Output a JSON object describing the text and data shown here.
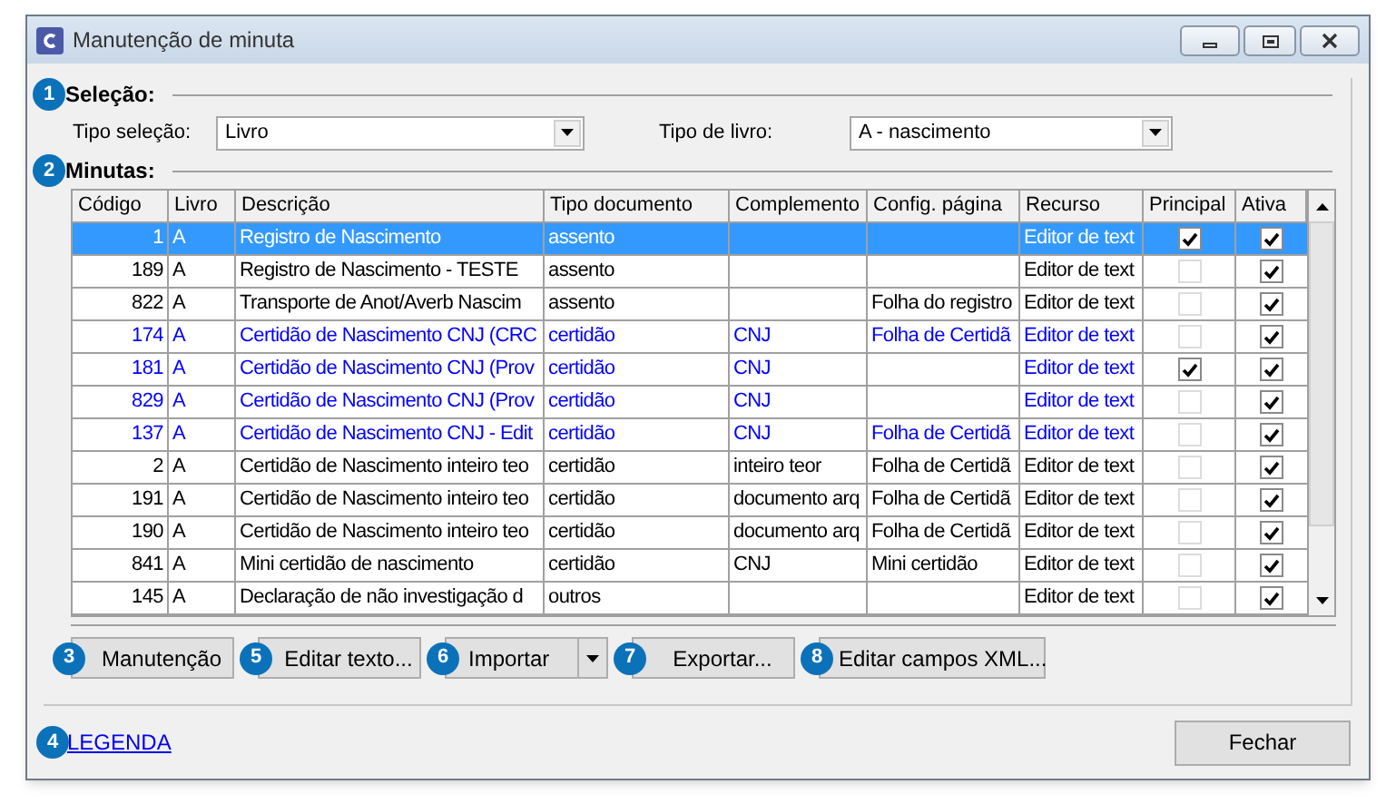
{
  "window": {
    "title": "Manutenção de minuta"
  },
  "selecao": {
    "badge": "1",
    "title": "Seleção:",
    "tipo_selecao_label": "Tipo seleção:",
    "tipo_selecao_value": "Livro",
    "tipo_livro_label": "Tipo de livro:",
    "tipo_livro_value": "A - nascimento"
  },
  "minutas": {
    "badge": "2",
    "title": "Minutas:"
  },
  "table": {
    "columns": [
      "Código",
      "Livro",
      "Descrição",
      "Tipo documento",
      "Complemento",
      "Config. página",
      "Recurso",
      "Principal",
      "Ativa"
    ],
    "rows": [
      {
        "codigo": "1",
        "livro": "A",
        "descricao": "Registro de Nascimento",
        "tipo": "assento",
        "complemento": "",
        "config": "",
        "recurso": "Editor de text",
        "principal": true,
        "ativa": true,
        "selected": true,
        "kind": "normal"
      },
      {
        "codigo": "189",
        "livro": "A",
        "descricao": "Registro de Nascimento - TESTE",
        "tipo": "assento",
        "complemento": "",
        "config": "",
        "recurso": "Editor de text",
        "principal": false,
        "ativa": true,
        "selected": false,
        "kind": "normal"
      },
      {
        "codigo": "822",
        "livro": "A",
        "descricao": "Transporte de Anot/Averb Nascim",
        "tipo": "assento",
        "complemento": "",
        "config": "Folha do registro",
        "recurso": "Editor de text",
        "principal": false,
        "ativa": true,
        "selected": false,
        "kind": "normal"
      },
      {
        "codigo": "174",
        "livro": "A",
        "descricao": "Certidão de Nascimento CNJ (CRC",
        "tipo": "certidão",
        "complemento": "CNJ",
        "config": "Folha de Certidã",
        "recurso": "Editor de text",
        "principal": false,
        "ativa": true,
        "selected": false,
        "kind": "cnj"
      },
      {
        "codigo": "181",
        "livro": "A",
        "descricao": "Certidão de Nascimento CNJ (Prov",
        "tipo": "certidão",
        "complemento": "CNJ",
        "config": "",
        "recurso": "Editor de text",
        "principal": true,
        "ativa": true,
        "selected": false,
        "kind": "cnj"
      },
      {
        "codigo": "829",
        "livro": "A",
        "descricao": "Certidão de Nascimento CNJ (Prov",
        "tipo": "certidão",
        "complemento": "CNJ",
        "config": "",
        "recurso": "Editor de text",
        "principal": false,
        "ativa": true,
        "selected": false,
        "kind": "cnj"
      },
      {
        "codigo": "137",
        "livro": "A",
        "descricao": "Certidão de Nascimento CNJ - Edit",
        "tipo": "certidão",
        "complemento": "CNJ",
        "config": "Folha de Certidã",
        "recurso": "Editor de text",
        "principal": false,
        "ativa": true,
        "selected": false,
        "kind": "cnj"
      },
      {
        "codigo": "2",
        "livro": "A",
        "descricao": "Certidão de Nascimento inteiro teo",
        "tipo": "certidão",
        "complemento": "inteiro teor",
        "config": "Folha de Certidã",
        "recurso": "Editor de text",
        "principal": false,
        "ativa": true,
        "selected": false,
        "kind": "normal"
      },
      {
        "codigo": "191",
        "livro": "A",
        "descricao": "Certidão de Nascimento inteiro teo",
        "tipo": "certidão",
        "complemento": "documento arq",
        "config": "Folha de Certidã",
        "recurso": "Editor de text",
        "principal": false,
        "ativa": true,
        "selected": false,
        "kind": "normal"
      },
      {
        "codigo": "190",
        "livro": "A",
        "descricao": "Certidão de Nascimento inteiro teo",
        "tipo": "certidão",
        "complemento": "documento arq",
        "config": "Folha de Certidã",
        "recurso": "Editor de text",
        "principal": false,
        "ativa": true,
        "selected": false,
        "kind": "normal"
      },
      {
        "codigo": "841",
        "livro": "A",
        "descricao": "Mini certidão de nascimento",
        "tipo": "certidão",
        "complemento": "CNJ",
        "config": "Mini certidão",
        "recurso": "Editor de text",
        "principal": false,
        "ativa": true,
        "selected": false,
        "kind": "normal"
      },
      {
        "codigo": "145",
        "livro": "A",
        "descricao": "Declaração de não investigação d",
        "tipo": "outros",
        "complemento": "",
        "config": "",
        "recurso": "Editor de text",
        "principal": false,
        "ativa": true,
        "selected": false,
        "kind": "normal"
      }
    ]
  },
  "buttons": [
    {
      "badge": "3",
      "label": "Manutenção",
      "kind": "plain"
    },
    {
      "badge": "5",
      "label": "Editar texto...",
      "kind": "plain"
    },
    {
      "badge": "6",
      "label": "Importar",
      "kind": "split"
    },
    {
      "badge": "7",
      "label": "Exportar...",
      "kind": "plain"
    },
    {
      "badge": "8",
      "label": "Editar campos XML...",
      "kind": "plain"
    }
  ],
  "legend": {
    "badge": "4",
    "label": "LEGENDA"
  },
  "close_button": {
    "label": "Fechar"
  }
}
